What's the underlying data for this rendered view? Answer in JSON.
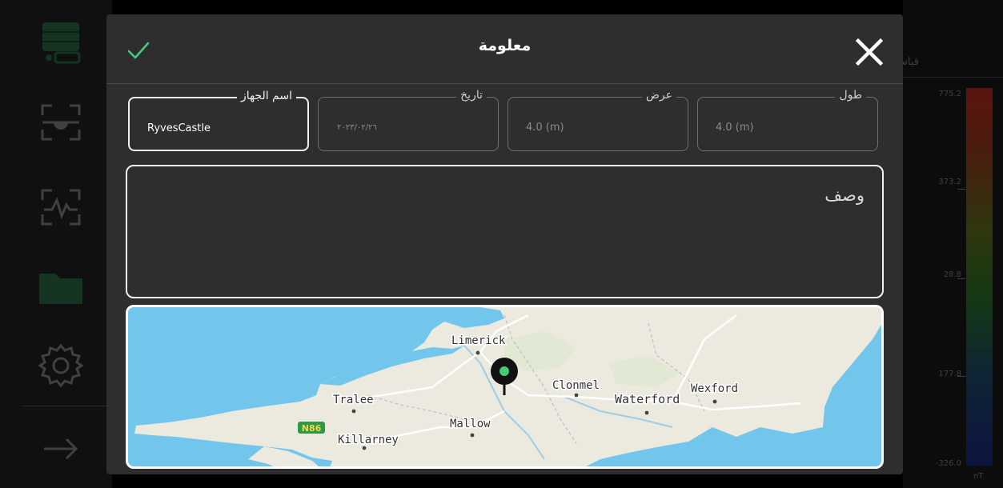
{
  "background": {
    "sidebar_icons": [
      "storage-icon",
      "radar-icon",
      "waveform-icon",
      "folder-icon",
      "gear-icon",
      "arrow-right-icon"
    ],
    "scale": {
      "labels": [
        "775.2",
        "373.2",
        "28.8",
        "177.8",
        "-326.0"
      ],
      "unit": "nT"
    },
    "header_fragment": "قياس"
  },
  "dialog": {
    "title": "معلومة",
    "fields": {
      "device_name": {
        "label": "اسم الجهاز",
        "value": "RyvesCastle"
      },
      "date": {
        "label": "تاريخ",
        "value": "٢٠٢٣/٠٢/٢٦"
      },
      "width": {
        "label": "عرض",
        "value": "4.0 (m)"
      },
      "length": {
        "label": "طول",
        "value": "4.0 (m)"
      }
    },
    "description": {
      "placeholder": "وصف"
    },
    "map": {
      "places": [
        "Limerick",
        "Clonmel",
        "Waterford",
        "Wexford",
        "Tralee",
        "Mallow",
        "Killarney"
      ],
      "road_shield": "N86"
    }
  },
  "colors": {
    "accent_green": "#45c97a",
    "dialog_bg": "#2e2e30",
    "water": "#72c6ec",
    "land": "#ece9df"
  }
}
